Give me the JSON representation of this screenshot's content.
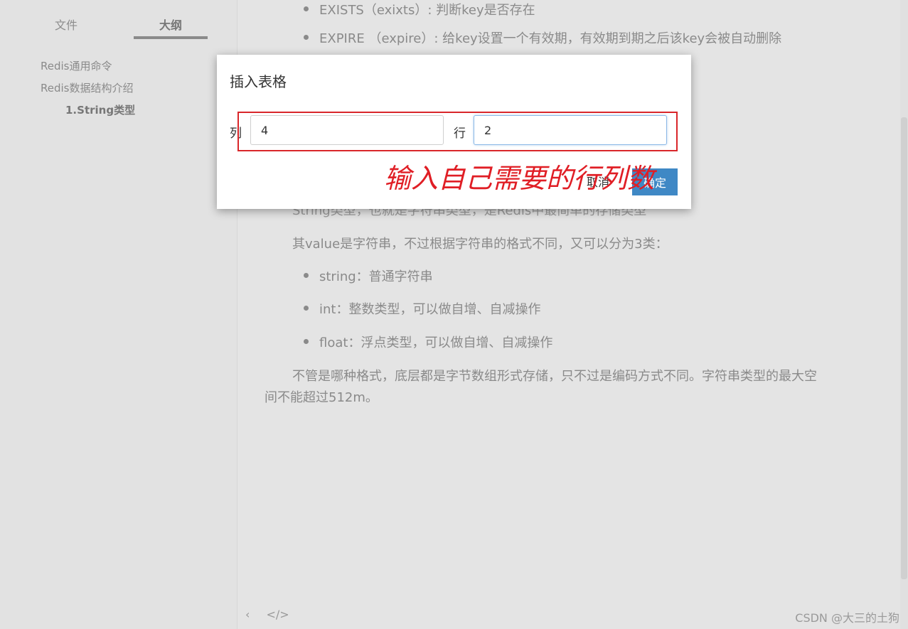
{
  "sidebar": {
    "tabs": [
      {
        "label": "文件"
      },
      {
        "label": "大纲"
      }
    ],
    "outline": [
      {
        "label": "Redis通用命令"
      },
      {
        "label": "Redis数据结构介绍"
      },
      {
        "label": "1.String类型"
      }
    ]
  },
  "content": {
    "bullets_top": [
      "EXISTS（exixts）: 判断key是否存在",
      "EXPIRE （expire）: 给key设置一个有效期，有效期到期之后该key会被自动删除"
    ],
    "para_obscured": "String类型，也就是字符串类型，是Redis中最简单的存储类型",
    "para_value": "其value是字符串，不过根据字符串的格式不同，又可以分为3类：",
    "bullets_types": [
      "string：普通字符串",
      "int：整数类型，可以做自增、自减操作",
      "float：浮点类型，可以做自增、自减操作"
    ],
    "para_last_1": "不管是哪种格式，底层都是字节数组形式存储，只不过是编码方式不同。字符串类型的最大空",
    "para_last_2": "间不能超过512m。"
  },
  "footer": {
    "back_icon": "‹",
    "code_icon": "</>",
    "watermark": "CSDN @大三的土狗"
  },
  "dialog": {
    "title": "插入表格",
    "cols_label": "列",
    "cols_value": "4",
    "rows_label": "行",
    "rows_value": "2",
    "cancel_label": "取消",
    "ok_label": "确定",
    "annotation": "输入自己需要的行列数"
  },
  "colors": {
    "accent": "#3f88c5",
    "annotation_red": "#e01e25"
  }
}
